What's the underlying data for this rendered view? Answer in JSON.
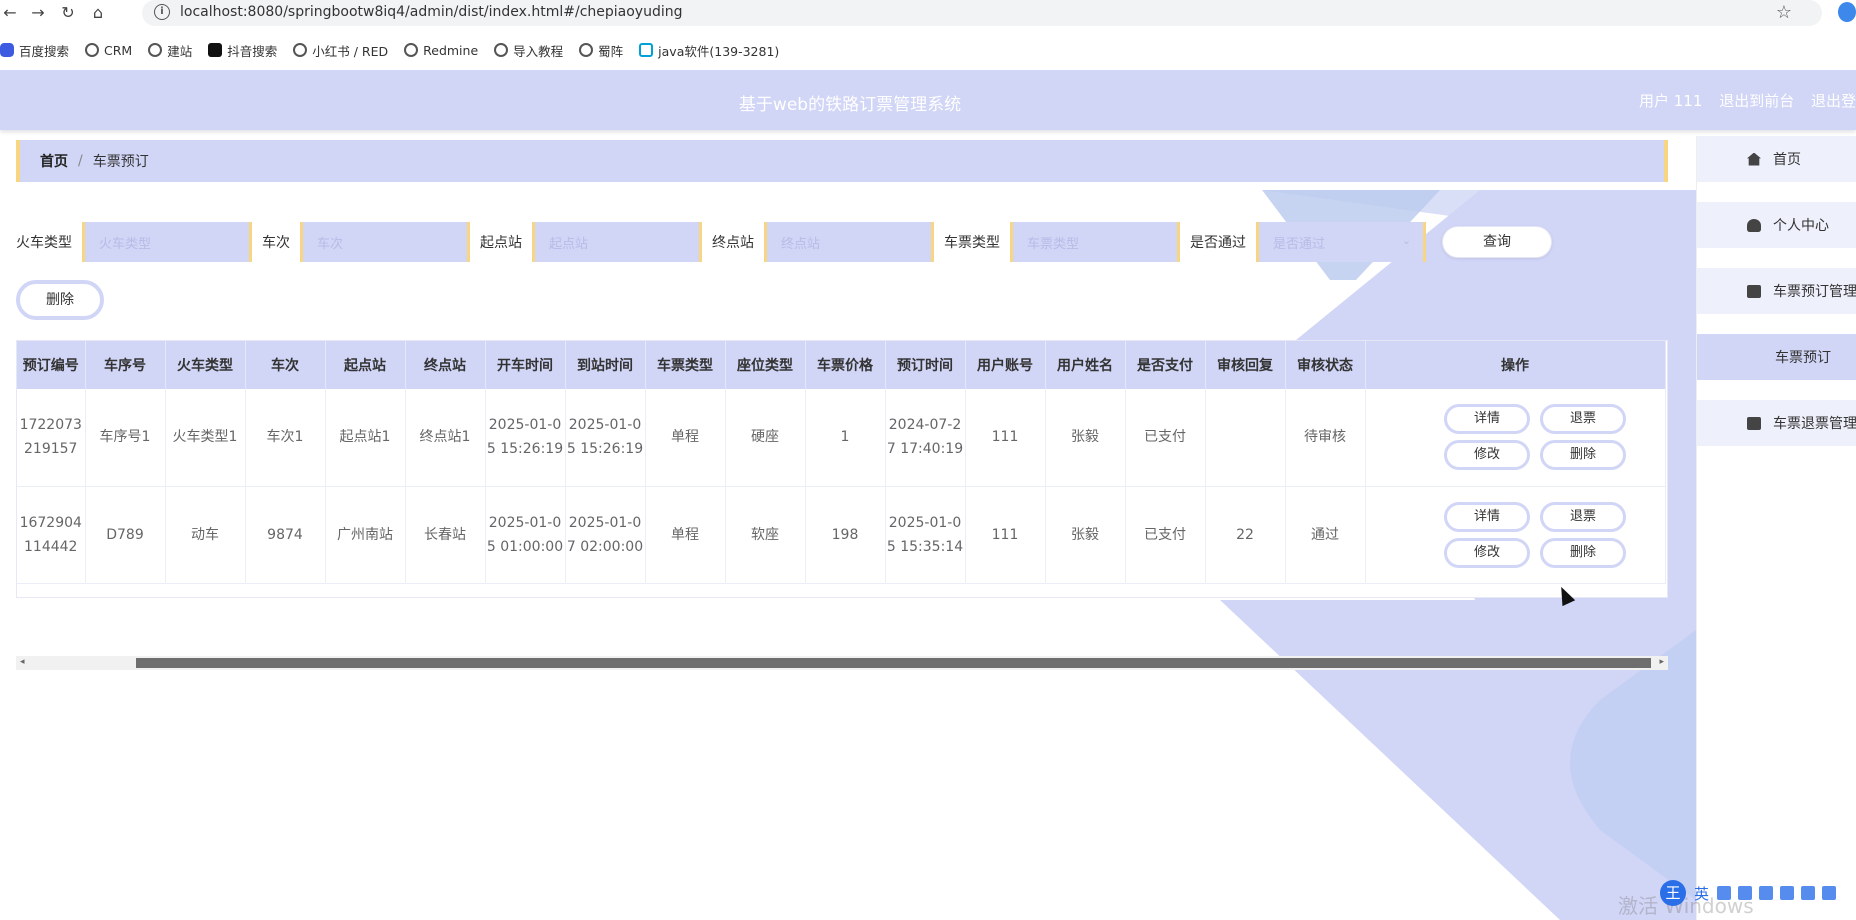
{
  "browser": {
    "url": "localhost:8080/springbootw8iq4/admin/dist/index.html#/chepiaoyuding",
    "bookmarks": [
      "百度搜索",
      "CRM",
      "建站",
      "抖音搜索",
      "小红书 / RED",
      "Redmine",
      "导入教程",
      "蜀阵",
      "java软件(139-3281)"
    ]
  },
  "header": {
    "title": "基于web的铁路订票管理系统",
    "user_label": "用户 111",
    "to_front": "退出到前台",
    "logout": "退出登"
  },
  "breadcrumb": {
    "home": "首页",
    "sep": "/",
    "current": "车票预订"
  },
  "search": {
    "fields": [
      {
        "label": "火车类型",
        "placeholder": "火车类型"
      },
      {
        "label": "车次",
        "placeholder": "车次"
      },
      {
        "label": "起点站",
        "placeholder": "起点站"
      },
      {
        "label": "终点站",
        "placeholder": "终点站"
      },
      {
        "label": "车票类型",
        "placeholder": "车票类型"
      },
      {
        "label": "是否通过",
        "placeholder": "是否通过"
      }
    ],
    "query_label": "查询"
  },
  "actions": {
    "delete_label": "删除"
  },
  "table": {
    "columns": [
      "预订编号",
      "车序号",
      "火车类型",
      "车次",
      "起点站",
      "终点站",
      "开车时间",
      "到站时间",
      "车票类型",
      "座位类型",
      "车票价格",
      "预订时间",
      "用户账号",
      "用户姓名",
      "是否支付",
      "审核回复",
      "审核状态",
      "操作"
    ],
    "rows": [
      [
        "1722073219157",
        "车序号1",
        "火车类型1",
        "车次1",
        "起点站1",
        "终点站1",
        "2025-01-05 15:26:19",
        "2025-01-05 15:26:19",
        "单程",
        "硬座",
        "1",
        "2024-07-27 17:40:19",
        "111",
        "张毅",
        "已支付",
        "",
        "待审核"
      ],
      [
        "1672904114442",
        "D789",
        "动车",
        "9874",
        "广州南站",
        "长春站",
        "2025-01-05 01:00:00",
        "2025-01-07 02:00:00",
        "单程",
        "软座",
        "198",
        "2025-01-05 15:35:14",
        "111",
        "张毅",
        "已支付",
        "22",
        "通过"
      ]
    ],
    "row_buttons": {
      "detail": "详情",
      "refund": "退票",
      "edit": "修改",
      "delete": "删除"
    }
  },
  "sidebar": {
    "items": [
      {
        "label": "首页",
        "icon": "home-icon"
      },
      {
        "label": "个人中心",
        "icon": "user-icon"
      },
      {
        "label": "车票预订管理",
        "icon": "message-icon"
      },
      {
        "label": "车票预订",
        "icon": ""
      },
      {
        "label": "车票退票管理",
        "icon": "briefcase-icon"
      }
    ]
  },
  "system": {
    "watermark": "激活 Windows",
    "ime_mode": "英",
    "ime_logo": "王"
  },
  "colors": {
    "primary": "#d1d5f6",
    "accent": "#f8d580"
  }
}
